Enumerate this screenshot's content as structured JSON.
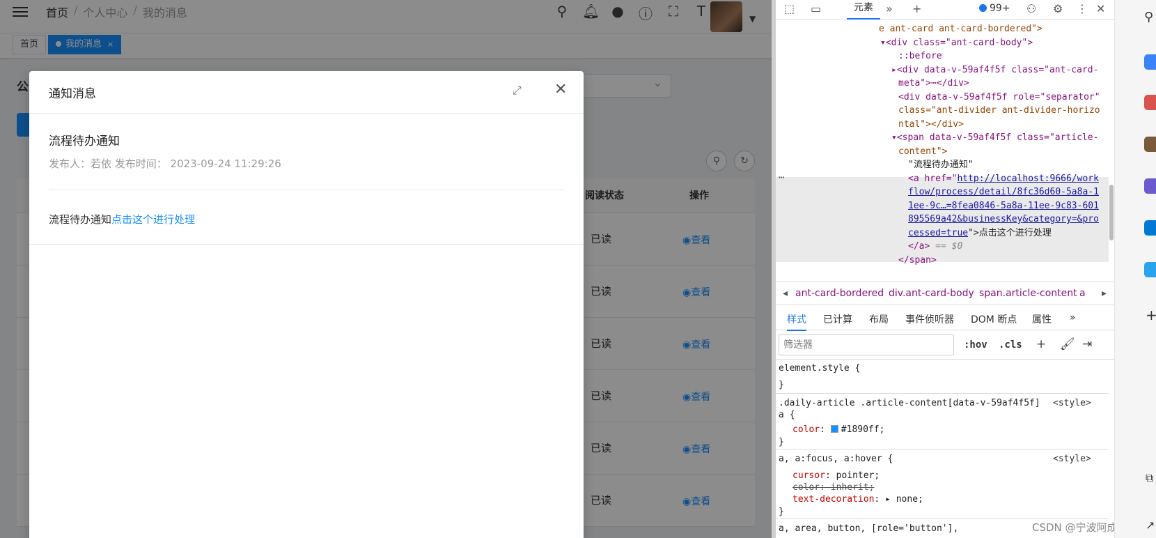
{
  "app": {
    "breadcrumb": [
      "首页",
      "个人中心",
      "我的消息"
    ],
    "breadcrumb_sep": "/",
    "nav_icons": [
      "search-icon",
      "bell-icon",
      "github-icon",
      "question-icon",
      "fullscreen-icon",
      "font-size-icon"
    ],
    "tags": [
      {
        "label": "首页",
        "active": false
      },
      {
        "label": "我的消息",
        "active": true,
        "close": "×"
      }
    ],
    "page_label": "公",
    "table": {
      "headers": {
        "read_status": "阅读状态",
        "action": "操作"
      },
      "rows": [
        {
          "status": "已读",
          "action": "查看"
        },
        {
          "status": "已读",
          "action": "查看"
        },
        {
          "status": "已读",
          "action": "查看"
        },
        {
          "status": "已读",
          "action": "查看"
        },
        {
          "status": "已读",
          "action": "查看"
        },
        {
          "status": "已读",
          "action": "查看"
        }
      ]
    }
  },
  "modal": {
    "title": "通知消息",
    "article_title": "流程待办通知",
    "meta": "发布人：若依 发布时间： 2023-09-24 11:29:26",
    "content_text": "流程待办通知",
    "content_link": "点击这个进行处理"
  },
  "devtools": {
    "elements_tab": "元素",
    "badge": "99+",
    "dom_lines": [
      {
        "t": "e ant-card ant-card-bordered\">"
      },
      {
        "t": "div class=\"ant-card-body\""
      },
      {
        "t": "::before"
      },
      {
        "t": "div data-v-59af4f5f class=\"ant-card-"
      },
      {
        "t": "meta\">⋯</div>"
      },
      {
        "t": "div data-v-59af4f5f role=\"separator\""
      },
      {
        "t": "class=\"ant-divider ant-divider-horizo"
      },
      {
        "t": "ntal\"></div>"
      },
      {
        "t": "span data-v-59af4f5f class=\"article-"
      },
      {
        "t": "content\">"
      },
      {
        "t": "\"流程待办通知\""
      },
      {
        "t": "<a href=\""
      },
      {
        "t": "http://localhost:9666/work"
      },
      {
        "t": "flow/process/detail/8fc36d60-5a8a-1"
      },
      {
        "t": "1ee-9c…=8fea0846-5a8a-11ee-9c83-601"
      },
      {
        "t": "895569a42&businessKey&category=&pro"
      },
      {
        "t": "cessed=true"
      },
      {
        "t": "\">点击这个进行处理"
      },
      {
        "t": "</a>"
      },
      {
        "t": "== $0"
      },
      {
        "t": "</span>"
      }
    ],
    "crumbs": [
      "ant-card-bordered",
      "div.ant-card-body",
      "span.article-content",
      "a"
    ],
    "style_tabs": [
      "样式",
      "已计算",
      "布局",
      "事件侦听器",
      "DOM 断点",
      "属性"
    ],
    "filter_placeholder": "筛选器",
    "filter_hov": ":hov",
    "filter_cls": ".cls",
    "rules": {
      "element_style": "element.style {",
      "close": "}",
      "rule1_selector": ".daily-article .article-content[data-v-59af4f5f]",
      "rule1_selector2": "a {",
      "rule1_prop": "color",
      "rule1_val": "#1890ff;",
      "rule2_selector": "a, a:focus, a:hover {",
      "rule2_p1": "cursor",
      "rule2_v1": "pointer;",
      "rule2_p2": "color: inherit;",
      "rule2_p3": "text-decoration",
      "rule2_v3": "none;",
      "rule3_selector": "a, area, button, [role='button'],",
      "source": "<style>"
    },
    "watermark": "CSDN @宁波阿成"
  }
}
